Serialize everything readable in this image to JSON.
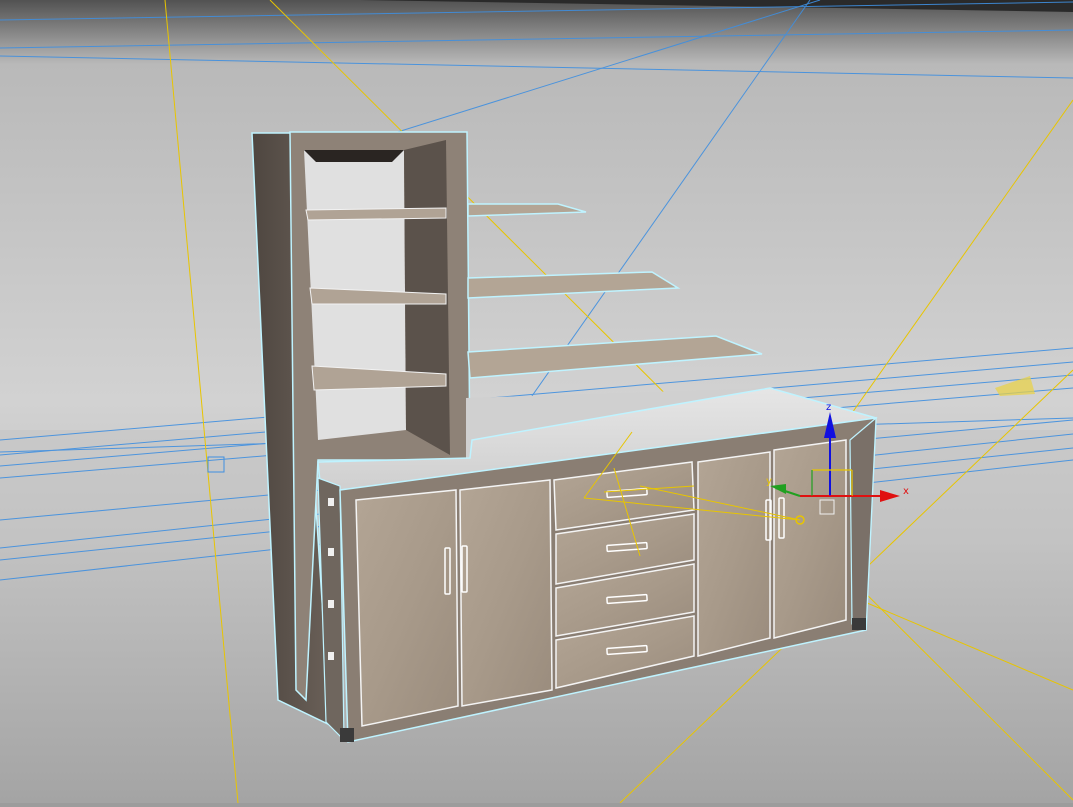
{
  "viewport": {
    "name": "3d-perspective-viewport",
    "model": "wall-unit-cabinet-with-shelves",
    "selection": "selected",
    "selection_highlight_color": "#bff3ff",
    "light_guide_color": "#e8c500",
    "grid_guide_color": "#3f8fe0"
  },
  "gizmo": {
    "type": "move-transform",
    "axes": [
      {
        "label": "x",
        "color": "#e01010"
      },
      {
        "label": "y",
        "color": "#20a020"
      },
      {
        "label": "z",
        "color": "#1010e0"
      }
    ]
  },
  "materials": {
    "wood_light": "#a89a8a",
    "wood_dark": "#5a514a",
    "interior": "#dcdcdc"
  }
}
